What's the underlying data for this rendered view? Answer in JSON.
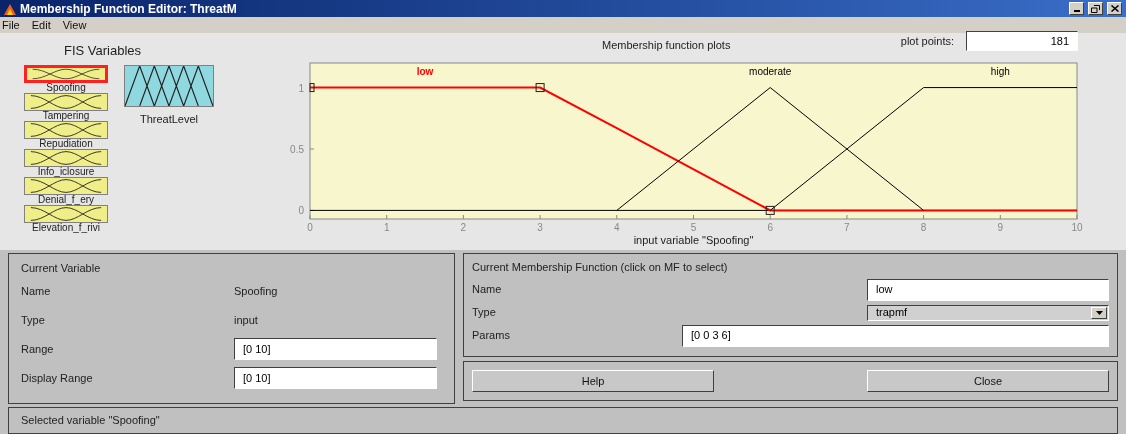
{
  "window": {
    "title": "Membership Function Editor: ThreatM"
  },
  "menu": [
    "File",
    "Edit",
    "View"
  ],
  "fis_variables": {
    "title": "FIS Variables",
    "inputs": [
      {
        "label": "Spoofing",
        "selected": true
      },
      {
        "label": "Tampering",
        "selected": false
      },
      {
        "label": "Repudiation",
        "selected": false
      },
      {
        "label": "Info_iclosure",
        "selected": false
      },
      {
        "label": "Denial_f_ery",
        "selected": false
      },
      {
        "label": "Elevation_f_rivi",
        "selected": false
      }
    ],
    "outputs": [
      {
        "label": "ThreatLevel",
        "selected": false
      }
    ]
  },
  "plot": {
    "plot_points": {
      "label": "plot points:",
      "value": "181"
    },
    "chart_data": {
      "type": "line",
      "title": "Membership function plots",
      "xlabel": "input variable \"Spoofing\"",
      "x": [
        0,
        3,
        4,
        6,
        8,
        10
      ],
      "xlim": [
        0,
        10
      ],
      "ylim": [
        -0.07,
        1.2
      ],
      "xticks": [
        0,
        1,
        2,
        3,
        4,
        5,
        6,
        7,
        8,
        9,
        10
      ],
      "yticks": [
        0,
        0.5,
        1
      ],
      "series": [
        {
          "name": "low",
          "color": "#ff0000",
          "values": [
            1,
            1,
            0.67,
            0,
            0,
            0
          ]
        },
        {
          "name": "moderate",
          "color": "#000000",
          "values": [
            null,
            null,
            0,
            1,
            0,
            null
          ]
        },
        {
          "name": "high",
          "color": "#000000",
          "values": [
            null,
            null,
            null,
            0,
            1,
            1
          ]
        }
      ]
    },
    "curves": [
      {
        "selected": true
      },
      {
        "selected": false
      },
      {
        "selected": false
      }
    ]
  },
  "current_variable": {
    "title": "Current Variable",
    "name": {
      "label": "Name",
      "value": "Spoofing"
    },
    "type": {
      "label": "Type",
      "value": "input"
    },
    "range": {
      "label": "Range",
      "value": "[0 10]"
    },
    "display_range": {
      "label": "Display Range",
      "value": "[0 10]"
    }
  },
  "current_mf": {
    "title": "Current Membership Function (click on MF to select)",
    "name": {
      "label": "Name",
      "value": "low"
    },
    "type": {
      "label": "Type",
      "value": "trapmf"
    },
    "params": {
      "label": "Params",
      "value": "[0 0 3 6]"
    }
  },
  "buttons": [
    "Help",
    "Close"
  ],
  "status": "Selected variable \"Spoofing\""
}
